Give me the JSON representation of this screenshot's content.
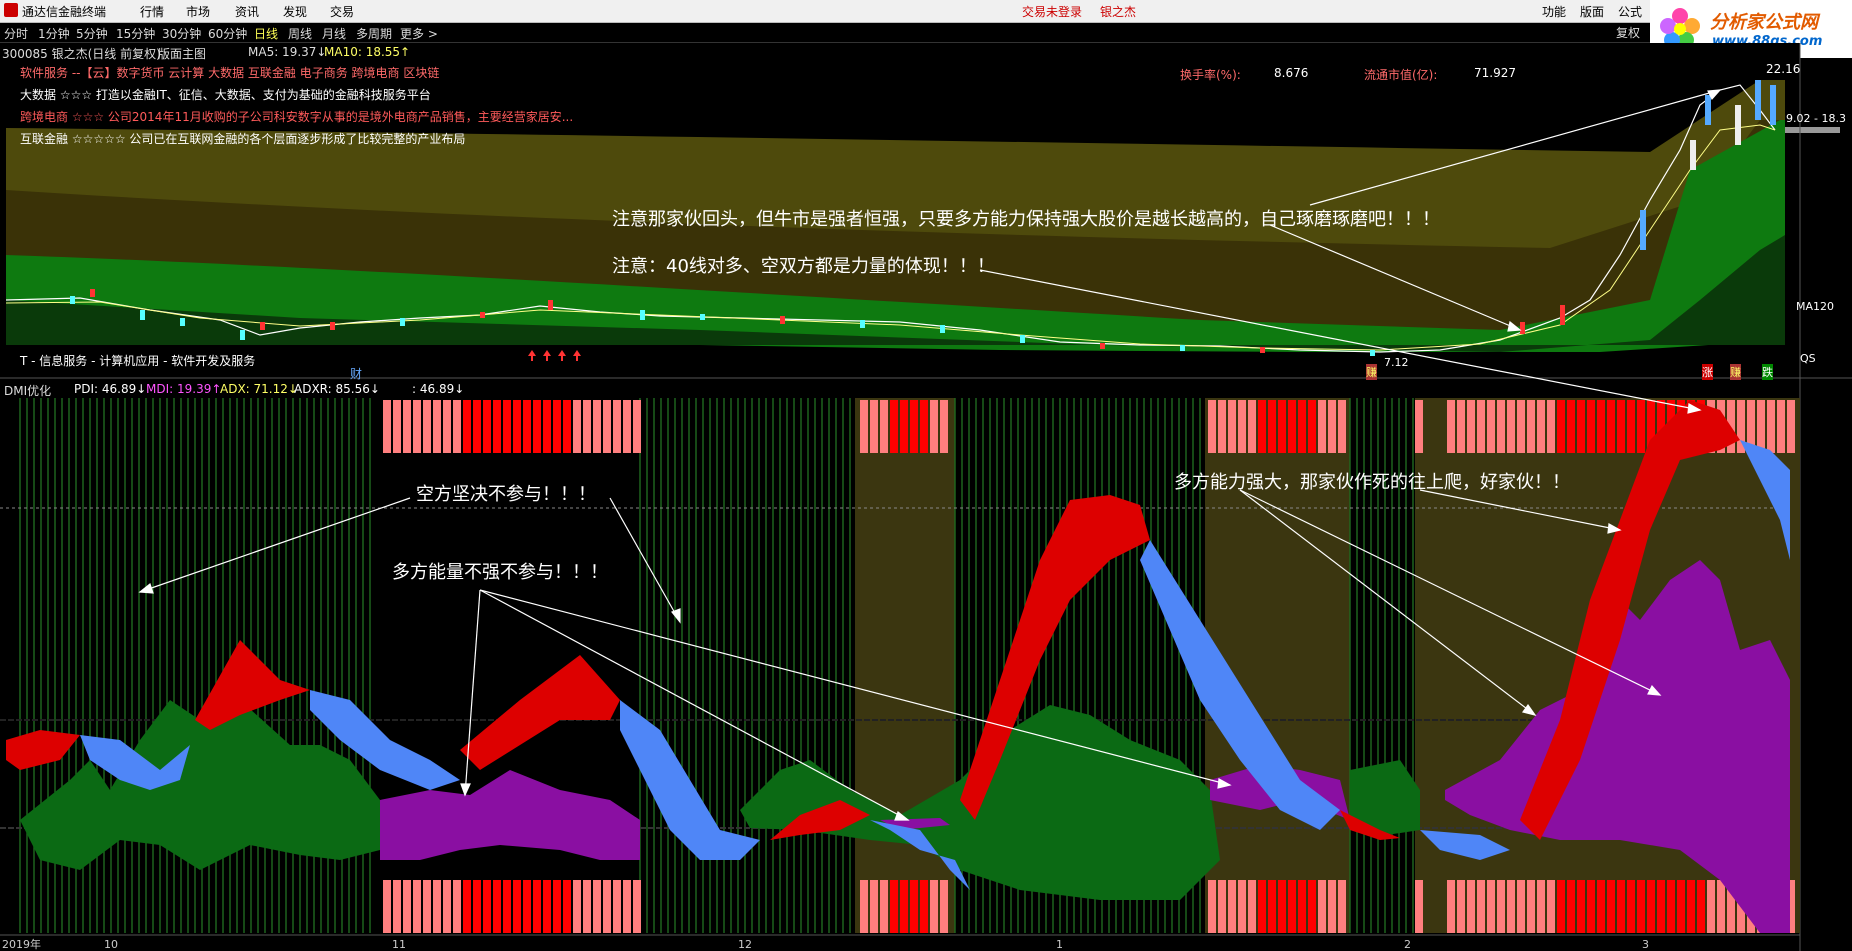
{
  "titlebar": {
    "app_name": "通达信金融终端",
    "menu": [
      "行情",
      "市场",
      "资讯",
      "发现",
      "交易"
    ],
    "trade_status": "交易未登录",
    "stock_name": "银之杰",
    "right_menu": [
      "功能",
      "版面",
      "公式"
    ]
  },
  "brand": {
    "name": "分析家公式网",
    "url": "www.88gs.com"
  },
  "periods": [
    "分时",
    "1分钟",
    "5分钟",
    "15分钟",
    "30分钟",
    "60分钟",
    "日线",
    "周线",
    "月线",
    "多周期",
    "更多 >"
  ],
  "active_period": "日线",
  "fuquan_label": "复权",
  "main": {
    "stock_line": "300085 银之杰(日线 前复权)",
    "layout_label": "版面主图",
    "ma5": "MA5: 19.37↓",
    "ma10": "MA10: 18.55↑",
    "software_line": "软件服务 --【云】数字货币 云计算 大数据 互联金融 电子商务 跨境电商 区块链",
    "turnover_label": "换手率(%):",
    "turnover_value": "8.676",
    "float_cap_label": "流通市值(亿):",
    "float_cap_value": "71.927",
    "concept_lines": [
      "大数据 ☆☆☆ 打造以金融IT、征信、大数据、支付为基础的金融科技服务平台",
      "跨境电商 ☆☆☆ 公司2014年11月收购的子公司科安数字从事的是境外电商产品销售，主要经营家居安...",
      "互联金融 ☆☆☆☆☆ 公司已在互联网金融的各个层面逐步形成了比较完整的产业布局"
    ],
    "price_high": "22.16",
    "price_range": "9.02 - 18.3",
    "ma120_label": "MA120",
    "price_low": "7.12",
    "industry_line": "T - 信息服务 - 计算机应用 - 软件开发及服务",
    "cai_marker": "财",
    "qs_label": "QS",
    "bottom_tags": [
      "赚",
      "涨",
      "赚",
      "跌"
    ]
  },
  "indicator": {
    "name": "DMI优化",
    "pdi": "PDI: 46.89↓",
    "mdi": "MDI: 19.39↑",
    "adx": "ADX: 71.12↓",
    "adxr": "ADXR: 85.56↓",
    "extra": ": 46.89↓"
  },
  "annotations": {
    "a1": "注意那家伙回头，但牛市是强者恒强，只要多方能力保持强大股价是越长越高的，自己琢磨琢磨吧！！！",
    "a2": "注意：40线对多、空双方都是力量的体现！！！",
    "a3": "空方坚决不参与！！！",
    "a4": "多方能量不强不参与！！！",
    "a5": "多方能力强大，那家伙作死的往上爬，好家伙！！"
  },
  "date_axis": [
    "2019年",
    "10",
    "11",
    "12",
    "1",
    "2",
    "3"
  ],
  "colors": {
    "bull_red": "#dd0000",
    "bear_blue": "#4f86f7",
    "pdi_green": "#0b6a14",
    "mdi_purple": "#8a0fa2",
    "band_olive": "#4e4a0c",
    "band_green": "#0e7a10"
  }
}
